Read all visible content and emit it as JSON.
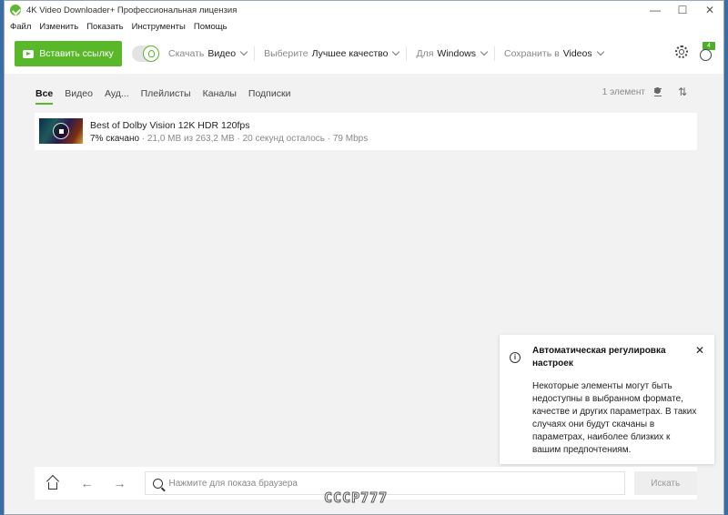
{
  "window": {
    "title": "4K Video Downloader+ Профессиональная лицензия",
    "minimize": "—",
    "maximize": "☐",
    "close": "✕"
  },
  "menu": [
    "Файл",
    "Изменить",
    "Показать",
    "Инструменты",
    "Помощь"
  ],
  "toolbar": {
    "paste_label": "Вставить ссылку",
    "download_label": "Скачать",
    "download_value": "Видео",
    "quality_label": "Выберите",
    "quality_value": "Лучшее качество",
    "for_label": "Для",
    "for_value": "Windows",
    "save_label": "Сохранить в",
    "save_value": "Videos",
    "account_badge": "4"
  },
  "tabs": [
    "Все",
    "Видео",
    "Ауд...",
    "Плейлисты",
    "Каналы",
    "Подписки"
  ],
  "list": {
    "count": "1 элемент",
    "sort_icon": "⇅"
  },
  "download_item": {
    "title": "Best of Dolby Vision 12K HDR 120fps",
    "percent": "7% скачано",
    "details": " · 21,0 MB из 263,2 MB · 20 секунд осталось · 79 Mbps",
    "progress": 0.07
  },
  "toast": {
    "icon": "i",
    "title": "Автоматическая регулировка настроек",
    "close": "✕",
    "body": "Некоторые элементы могут быть недоступны в выбранном формате, качестве и других параметрах. В таких случаях они будут скачаны в параметрах, наиболее близких к вашим предпочтениям."
  },
  "browser_bar": {
    "back": "←",
    "forward": "→",
    "placeholder": "Нажмите для показа браузера",
    "search_label": "Искать"
  },
  "watermark": "CCCP777"
}
